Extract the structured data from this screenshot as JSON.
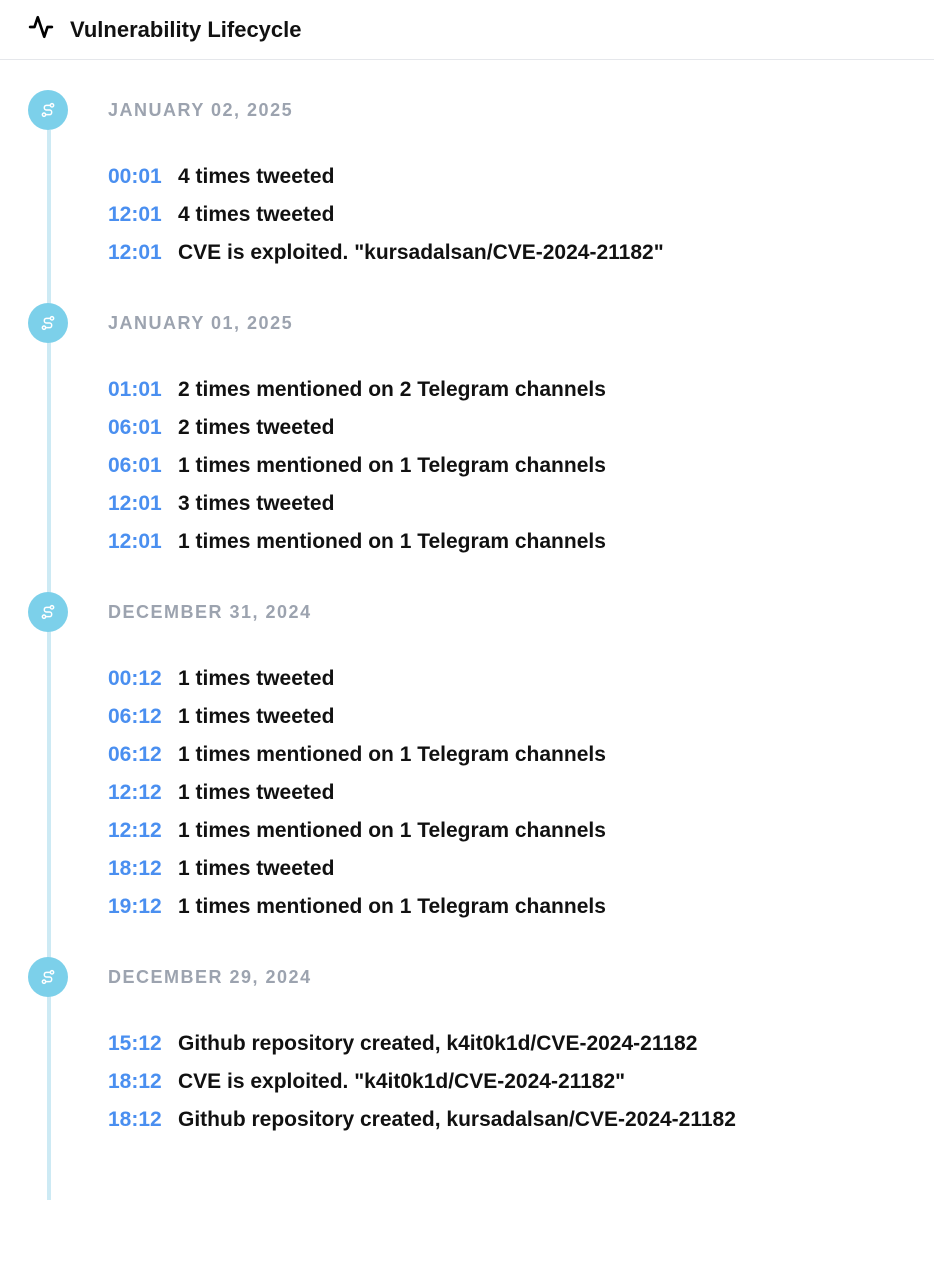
{
  "header": {
    "title": "Vulnerability Lifecycle"
  },
  "timeline": [
    {
      "date": "JANUARY 02, 2025",
      "events": [
        {
          "time": "00:01",
          "desc": "4 times tweeted"
        },
        {
          "time": "12:01",
          "desc": "4 times tweeted"
        },
        {
          "time": "12:01",
          "desc": "CVE is exploited. \"kursadalsan/CVE-2024-21182\""
        }
      ]
    },
    {
      "date": "JANUARY 01, 2025",
      "events": [
        {
          "time": "01:01",
          "desc": "2 times mentioned on 2 Telegram channels"
        },
        {
          "time": "06:01",
          "desc": "2 times tweeted"
        },
        {
          "time": "06:01",
          "desc": "1 times mentioned on 1 Telegram channels"
        },
        {
          "time": "12:01",
          "desc": "3 times tweeted"
        },
        {
          "time": "12:01",
          "desc": "1 times mentioned on 1 Telegram channels"
        }
      ]
    },
    {
      "date": "DECEMBER 31, 2024",
      "events": [
        {
          "time": "00:12",
          "desc": "1 times tweeted"
        },
        {
          "time": "06:12",
          "desc": "1 times tweeted"
        },
        {
          "time": "06:12",
          "desc": "1 times mentioned on 1 Telegram channels"
        },
        {
          "time": "12:12",
          "desc": "1 times tweeted"
        },
        {
          "time": "12:12",
          "desc": "1 times mentioned on 1 Telegram channels"
        },
        {
          "time": "18:12",
          "desc": "1 times tweeted"
        },
        {
          "time": "19:12",
          "desc": "1 times mentioned on 1 Telegram channels"
        }
      ]
    },
    {
      "date": "DECEMBER 29, 2024",
      "events": [
        {
          "time": "15:12",
          "desc": "Github repository created, k4it0k1d/CVE-2024-21182"
        },
        {
          "time": "18:12",
          "desc": "CVE is exploited. \"k4it0k1d/CVE-2024-21182\""
        },
        {
          "time": "18:12",
          "desc": "Github repository created, kursadalsan/CVE-2024-21182"
        }
      ]
    }
  ]
}
